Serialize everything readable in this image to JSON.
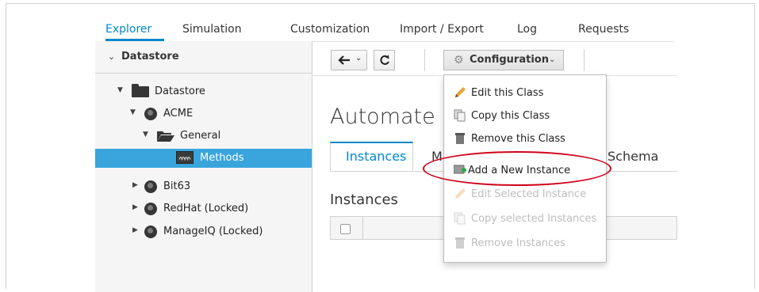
{
  "nav": {
    "tabs": [
      {
        "label": "Explorer",
        "active": true
      },
      {
        "label": "Simulation"
      },
      {
        "label": "Customization"
      },
      {
        "label": "Import / Export"
      },
      {
        "label": "Log"
      },
      {
        "label": "Requests"
      }
    ]
  },
  "sidebar": {
    "header": "Datastore",
    "tree": [
      {
        "label": "Datastore",
        "icon": "folder-icon"
      },
      {
        "label": "ACME",
        "icon": "globe-icon"
      },
      {
        "label": "General",
        "icon": "open-folder-icon"
      },
      {
        "label": "Methods",
        "icon": "methods-icon",
        "selected": true
      },
      {
        "label": "Bit63",
        "icon": "globe-icon"
      },
      {
        "label": "RedHat (Locked)",
        "icon": "globe-icon"
      },
      {
        "label": "ManageIQ (Locked)",
        "icon": "globe-icon"
      }
    ]
  },
  "toolbar": {
    "back_icon": "back-arrow-icon",
    "refresh_icon": "refresh-icon",
    "configuration_label": "Configuration"
  },
  "main": {
    "title": "Automate C",
    "tabs": [
      {
        "label": "Instances",
        "active": true
      },
      {
        "label": "M"
      },
      {
        "label": "Schema"
      }
    ],
    "section_title": "Instances"
  },
  "menu": {
    "items": [
      {
        "label": "Edit this Class",
        "icon": "pencil-icon",
        "disabled": false
      },
      {
        "label": "Copy this Class",
        "icon": "copy-icon",
        "disabled": false
      },
      {
        "label": "Remove this Class",
        "icon": "trash-icon",
        "disabled": false
      },
      {
        "label": "Add a New Instance",
        "icon": "add-instance-icon",
        "disabled": false,
        "highlighted": true
      },
      {
        "label": "Edit Selected Instance",
        "icon": "pencil-icon",
        "disabled": true
      },
      {
        "label": "Copy selected Instances",
        "icon": "copy-icon",
        "disabled": true
      },
      {
        "label": "Remove Instances",
        "icon": "trash-icon",
        "disabled": true
      }
    ]
  },
  "colors": {
    "accent": "#0088ce",
    "selected_row": "#39a5dc",
    "highlight": "#d0021b"
  }
}
